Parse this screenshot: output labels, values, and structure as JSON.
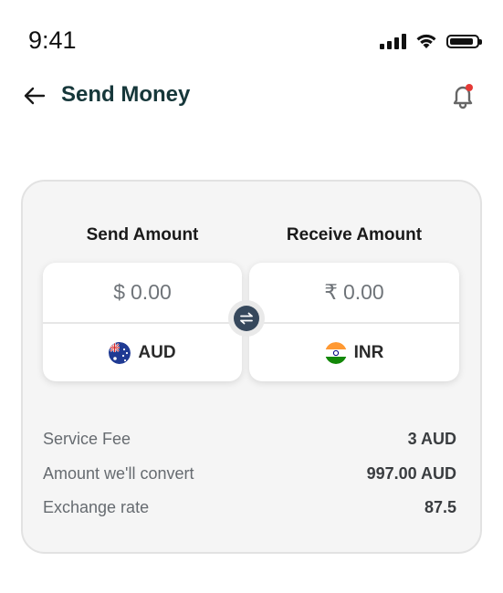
{
  "status_bar": {
    "time": "9:41",
    "icons": [
      "signal-icon",
      "wifi-icon",
      "battery-icon"
    ]
  },
  "header": {
    "back_icon": "arrow-left-icon",
    "title": "Send Money",
    "notification_icon": "bell-icon",
    "notification_dot_color": "#e53935"
  },
  "converter": {
    "send": {
      "label": "Send Amount",
      "symbol": "$",
      "amount": "0.00",
      "currency": "AUD",
      "flag": "australia-flag-icon"
    },
    "receive": {
      "label": "Receive Amount",
      "symbol": "₹",
      "amount": "0.00",
      "currency": "INR",
      "flag": "india-flag-icon"
    },
    "swap_icon": "swap-icon"
  },
  "details": [
    {
      "label": "Service Fee",
      "value": "3 AUD"
    },
    {
      "label": "Amount we'll convert",
      "value": "997.00 AUD"
    },
    {
      "label": "Exchange rate",
      "value": "87.5"
    }
  ],
  "colors": {
    "title": "#16373a",
    "card_background": "#f5f5f5",
    "swap_button": "#36485c"
  }
}
